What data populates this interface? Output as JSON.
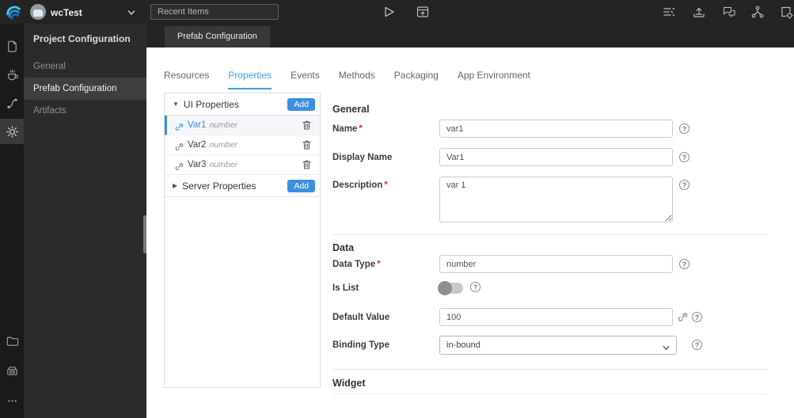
{
  "topbar": {
    "project_name": "wcTest",
    "recent_items_placeholder": "Recent Items",
    "toolbar_icons": [
      "run-icon",
      "preview-icon",
      "console-icon",
      "publish-icon",
      "feedback-icon",
      "fork-icon",
      "export-project-icon"
    ]
  },
  "sidebar": {
    "rail_icons": [
      "pages-icon",
      "java-services-icon",
      "bindings-icon",
      "settings-icon",
      "files-icon",
      "export-machine-icon",
      "more-icon"
    ],
    "panel_title": "Project Configuration",
    "items": [
      {
        "label": "General",
        "active": false
      },
      {
        "label": "Prefab Configuration",
        "active": true
      },
      {
        "label": "Artifacts",
        "active": false
      }
    ]
  },
  "document_tab": {
    "label": "Prefab Configuration"
  },
  "tabs": {
    "items": [
      {
        "label": "Resources",
        "active": false
      },
      {
        "label": "Properties",
        "active": true
      },
      {
        "label": "Events",
        "active": false
      },
      {
        "label": "Methods",
        "active": false
      },
      {
        "label": "Packaging",
        "active": false
      },
      {
        "label": "App Environment",
        "active": false
      }
    ]
  },
  "properties_panel": {
    "ui_group": {
      "caret": "▼",
      "title": "UI Properties",
      "add_label": "Add",
      "items": [
        {
          "name": "Var1",
          "type": "number",
          "selected": true
        },
        {
          "name": "Var2",
          "type": "number",
          "selected": false
        },
        {
          "name": "Var3",
          "type": "number",
          "selected": false
        }
      ]
    },
    "server_group": {
      "caret": "▶",
      "title": "Server Properties",
      "add_label": "Add"
    }
  },
  "form": {
    "required_marker": "*",
    "general": {
      "title": "General",
      "name": {
        "label": "Name",
        "value": "var1"
      },
      "display_name": {
        "label": "Display Name",
        "value": "Var1"
      },
      "description": {
        "label": "Description",
        "value": "var 1"
      }
    },
    "data": {
      "title": "Data",
      "data_type": {
        "label": "Data Type",
        "value": "number"
      },
      "is_list": {
        "label": "Is List",
        "state": "off"
      },
      "default_value": {
        "label": "Default Value",
        "value": "100"
      },
      "binding_type": {
        "label": "Binding Type",
        "value": "in-bound"
      }
    },
    "widget": {
      "title": "Widget"
    }
  },
  "icons": {
    "help_glyph": "?"
  },
  "colors": {
    "accent_blue": "#3d8fe0",
    "tab_active_blue": "#3fa0e8",
    "required_red": "#e53935",
    "topbar_dark": "#242424",
    "rail_dark": "#1a1a1a",
    "sidebar_dark": "#2b2b2b"
  }
}
